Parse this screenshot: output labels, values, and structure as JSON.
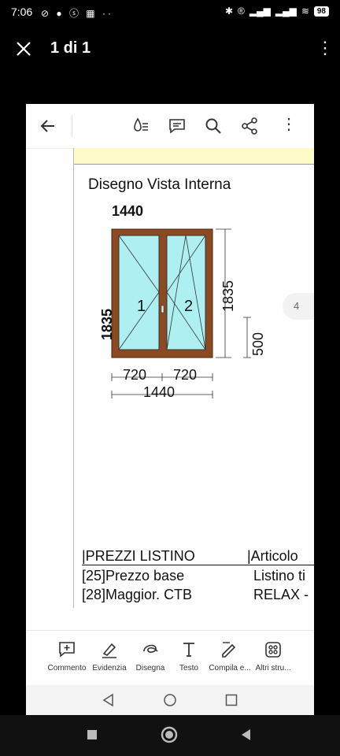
{
  "status": {
    "time": "7:06",
    "battery": "98"
  },
  "viewer": {
    "title": "1 di 1"
  },
  "document": {
    "page_title": "Disegno Vista Interna",
    "width_top": "1440",
    "height_left": "1835",
    "height_right": "1835",
    "handle_height": "500",
    "sash_1": "1",
    "sash_2": "2",
    "width_part_1": "720",
    "width_part_2": "720",
    "width_total": "1440",
    "page_indicator": "4",
    "table": {
      "header_col1": "|PREZZI LISTINO",
      "header_col2": "|Articolo",
      "row1_col1": "[25]Prezzo base",
      "row1_col2": "Listino ti",
      "row2_col1": "[28]Maggior. CTB",
      "row2_col2": "RELAX -"
    }
  },
  "tools": [
    {
      "label": "Commento",
      "icon": "comment-icon"
    },
    {
      "label": "Evidenzia",
      "icon": "highlight-icon"
    },
    {
      "label": "Disegna",
      "icon": "draw-icon"
    },
    {
      "label": "Testo",
      "icon": "text-icon"
    },
    {
      "label": "Compila e...",
      "icon": "fill-sign-icon"
    },
    {
      "label": "Altri stru...",
      "icon": "more-tools-icon"
    }
  ],
  "colors": {
    "frame": "#8b4a22",
    "glass": "#aef0f2",
    "dimension_red": "#a01414"
  }
}
